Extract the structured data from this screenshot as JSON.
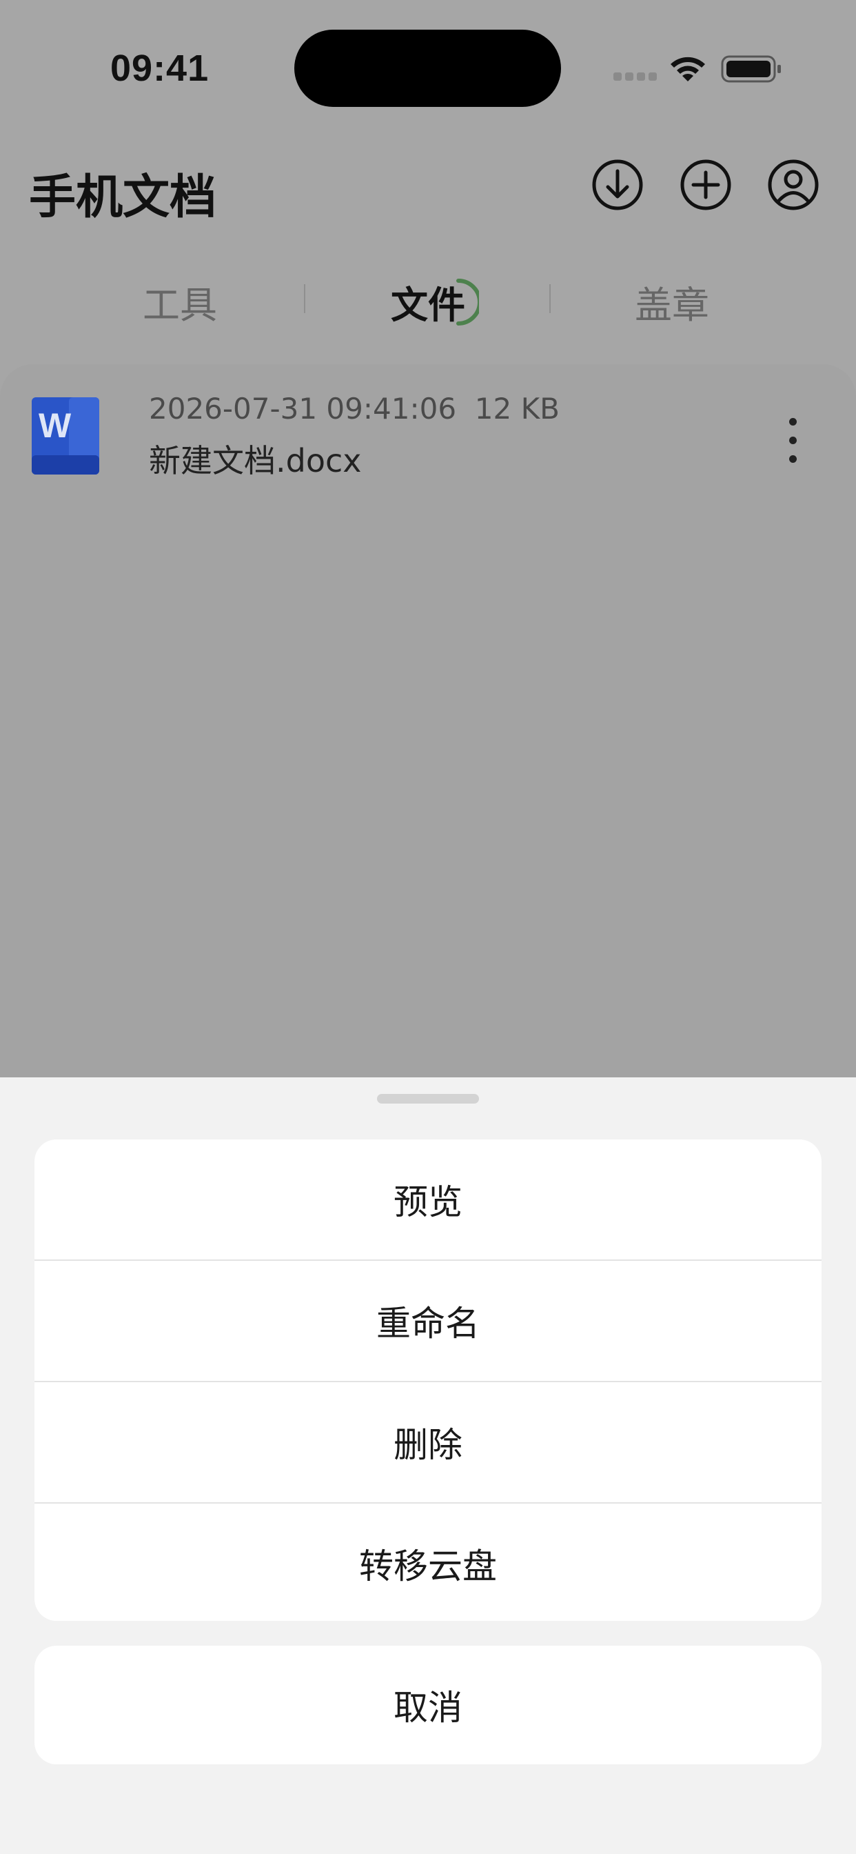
{
  "status_bar": {
    "time": "09:41"
  },
  "header": {
    "title": "手机文档",
    "icons": [
      "download-circle-icon",
      "plus-circle-icon",
      "user-circle-icon"
    ]
  },
  "tabs": [
    {
      "label": "工具",
      "active": false
    },
    {
      "label": "文件",
      "active": true
    },
    {
      "label": "盖章",
      "active": false
    }
  ],
  "files": [
    {
      "icon": "word-doc-icon",
      "modified": "2026-07-31 09:41:06",
      "size": "12 KB",
      "name": "新建文档.docx"
    }
  ],
  "action_sheet": {
    "actions": [
      {
        "label": "预览"
      },
      {
        "label": "重命名"
      },
      {
        "label": "删除"
      },
      {
        "label": "转移云盘"
      }
    ],
    "cancel_label": "取消"
  },
  "colors": {
    "overlay_bg": "#a6a6a6",
    "sheet_bg": "#f2f2f2",
    "word_blue": "#2a55c8",
    "tab_ring_green": "#3d7a3d"
  }
}
